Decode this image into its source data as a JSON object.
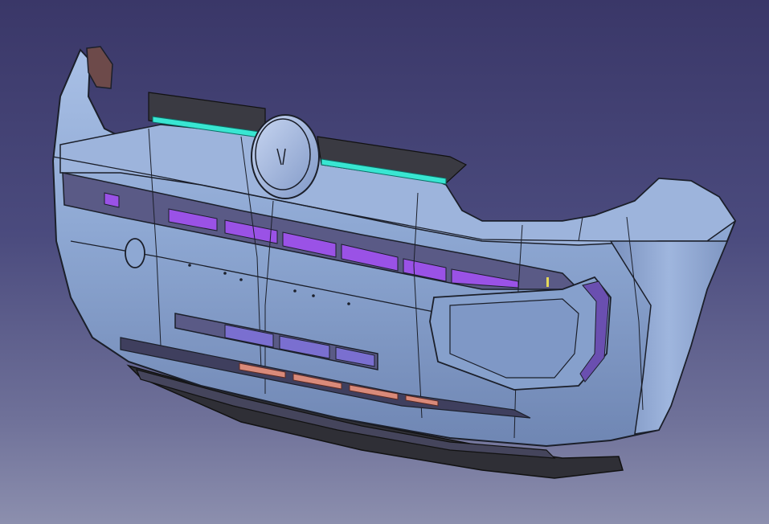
{
  "viewport": {
    "background_top": "#3a3768",
    "background_bottom": "#8c8fae"
  },
  "model": {
    "body_color": "#8aa3cf",
    "edge_color": "#1b1f2a",
    "grille_color": "#9a52e6",
    "accent_line_color": "#39e6d2",
    "reflector_color": "#d98a7a",
    "dark_part_color": "#2f2f36"
  }
}
